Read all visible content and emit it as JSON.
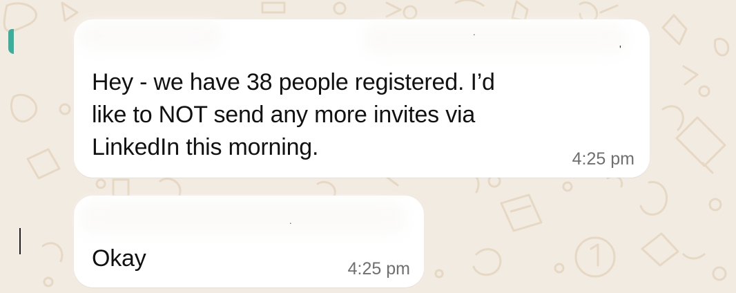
{
  "chat": {
    "messages": [
      {
        "lines": [
          "Hey - we have 38 people registered.  I’d",
          "like to NOT send any more invites via",
          "LinkedIn this morning."
        ],
        "time": "4:25 pm"
      },
      {
        "lines": [
          "Okay"
        ],
        "time": "4:25 pm"
      }
    ]
  },
  "wallpaper": {
    "background_color": "#f2ebe1",
    "doodle_color": "#e6d8c2",
    "accent_color": "#3cae9c"
  }
}
